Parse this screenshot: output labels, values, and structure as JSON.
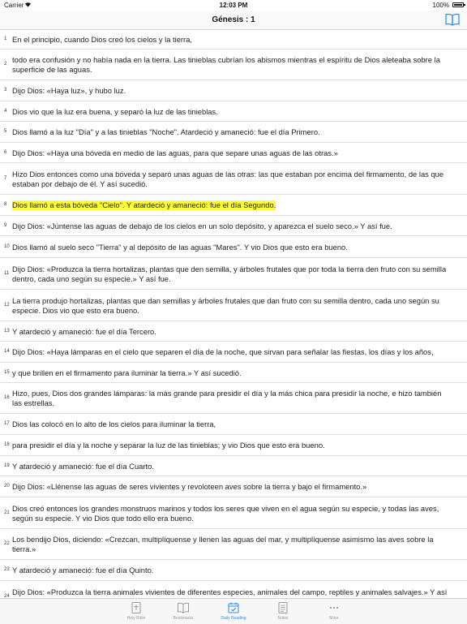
{
  "status_bar": {
    "carrier": "Carrier",
    "time": "12:03 PM",
    "battery": "100%"
  },
  "nav": {
    "title": "Génesis : 1",
    "book_icon": "open-book-icon"
  },
  "verses": [
    {
      "num": "1",
      "text": "En el principio, cuando Dios creó los cielos y la tierra,"
    },
    {
      "num": "2",
      "text": "todo era confusión y no había nada en la tierra. Las tinieblas cubrían los abismos mientras el espíritu de Dios aleteaba sobre la superficie de las aguas."
    },
    {
      "num": "3",
      "text": "Dijo Dios: «Haya luz», y hubo luz."
    },
    {
      "num": "4",
      "text": "Dios vio que la luz era buena, y separó la luz de las tinieblas."
    },
    {
      "num": "5",
      "text": "Dios llamó a la luz \"Día\" y a las tinieblas \"Noche\". Atardeció y amaneció: fue el día Primero."
    },
    {
      "num": "6",
      "text": "Dijo Dios: «Haya una bóveda en medio de las aguas, para que separe unas aguas de las otras.»"
    },
    {
      "num": "7",
      "text": "Hizo Dios entonces como una bóveda y separó unas aguas de las otras: las que estaban por encima del firmamento, de las que estaban por debajo de él. Y así sucedió."
    },
    {
      "num": "8",
      "text": "Dios llamó a esta bóveda \"Cielo\". Y atardeció y amaneció: fue el día Segundo.",
      "highlight": true
    },
    {
      "num": "9",
      "text": "Dijo Dios: «Júntense las aguas de debajo de los cielos en un solo depósito, y aparezca el suelo seco.» Y así fue."
    },
    {
      "num": "10",
      "text": "Dios llamó al suelo seco \"Tierra\" y al depósito de las aguas \"Mares\". Y vio Dios que esto era bueno."
    },
    {
      "num": "11",
      "text": "Dijo Dios: «Produzca la tierra hortalizas, plantas que den semilla, y árboles frutales que por toda la tierra den fruto con su semilla dentro, cada uno según su especie.» Y así fue."
    },
    {
      "num": "12",
      "text": "La tierra produjo hortalizas, plantas que dan semillas y árboles frutales que dan fruto con su semilla dentro, cada uno según su especie. Dios vio que esto era bueno."
    },
    {
      "num": "13",
      "text": "Y atardeció y amaneció: fue el día Tercero."
    },
    {
      "num": "14",
      "text": "Dijo Dios: «Haya lámparas en el cielo que separen el día de la noche, que sirvan para señalar las fiestas, los días y los años,"
    },
    {
      "num": "15",
      "text": "y que brillen en el firmamento para iluminar la tierra.» Y así sucedió."
    },
    {
      "num": "16",
      "text": "Hizo, pues, Dios dos grandes lámparas: la más grande para presidir el día y la más chica para presidir la noche, e hizo también las estrellas."
    },
    {
      "num": "17",
      "text": "Dios las colocó en lo alto de los cielos para iluminar la tierra,"
    },
    {
      "num": "18",
      "text": "para presidir el día y la noche y separar la luz de las tinieblas; y vio Dios que esto era bueno."
    },
    {
      "num": "19",
      "text": "Y atardeció y amaneció: fue el día Cuarto."
    },
    {
      "num": "20",
      "text": "Dijo Dios: «Llénense las aguas de seres vivientes y revoloteen aves sobre la tierra y bajo el firmamento.»"
    },
    {
      "num": "21",
      "text": "Dios creó entonces los grandes monstruos marinos y todos los seres que viven en el agua según su especie, y todas las aves, según su especie. Y vio Dios que todo ello era bueno."
    },
    {
      "num": "22",
      "text": "Los bendijo Dios, diciendo: «Crezcan, multiplíquense y llenen las aguas del mar, y multiplíquense asimismo las aves sobre la tierra.»"
    },
    {
      "num": "23",
      "text": "Y atardeció y amaneció: fue el día Quinto."
    },
    {
      "num": "24",
      "text": "Dijo Dios: «Produzca la tierra animales vivientes de diferentes especies, animales del campo, reptiles y animales salvajes.» Y así"
    }
  ],
  "tabs": [
    {
      "label": "Holy Bible",
      "icon": "bible-book-icon"
    },
    {
      "label": "Bookmarks",
      "icon": "open-book-icon"
    },
    {
      "label": "Daily Reading",
      "icon": "calendar-check-icon",
      "active": true
    },
    {
      "label": "Notes",
      "icon": "notes-icon"
    },
    {
      "label": "More",
      "icon": "more-dots-icon"
    }
  ],
  "colors": {
    "highlight": "#fffe3b",
    "accent": "#3a8ee6",
    "tab_inactive": "#9a9a9a"
  }
}
